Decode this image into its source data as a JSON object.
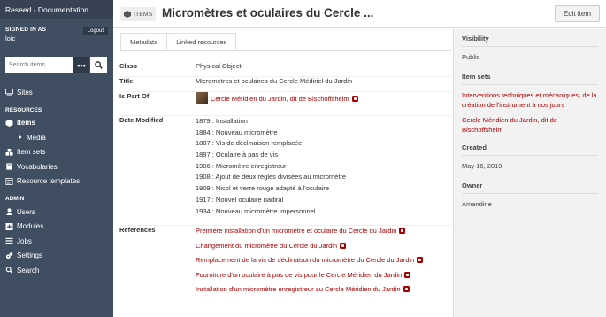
{
  "sidebar": {
    "brand": "Reseed - Documentation",
    "signed_in_label": "SIGNED IN AS",
    "user": "loic",
    "logout": "Logout",
    "search_placeholder": "Search items",
    "search_options_glyph": "•••",
    "search_button_icon": "search-icon",
    "nav": {
      "sites": "Sites",
      "resources_head": "RESOURCES",
      "items": "Items",
      "media": "Media",
      "item_sets": "Item sets",
      "vocabularies": "Vocabularies",
      "resource_templates": "Resource templates",
      "admin_head": "ADMIN",
      "users": "Users",
      "modules": "Modules",
      "jobs": "Jobs",
      "settings": "Settings",
      "search": "Search"
    }
  },
  "header": {
    "tag": "ITEMS",
    "title": "Micromètres et oculaires du Cercle ...",
    "edit": "Edit item"
  },
  "tabs": [
    "Metadata",
    "Linked resources"
  ],
  "properties": {
    "class_label": "Class",
    "class_value": "Physical Object",
    "title_label": "Title",
    "title_value": "Micromètres et oculaires du Cercle Médiriel du Jardin",
    "is_part_of_label": "Is Part Of",
    "is_part_of_value": "Cercle Méridien du Jardin, dit de Bischoffsheim",
    "date_modified_label": "Date Modified",
    "dates": [
      "1879 : Installation",
      "1884 : Nouveau micromètre",
      "1887 : Vis de déclinaison remplacée",
      "1897 : Oculaire à pas de vis",
      "1906 : Micromètre enregistreur",
      "1908 : Ajout de deux règles divisées au micromètre",
      "1909 : Nicol et verre rouge adapté à l'oculaire",
      "1917 : Nouvel oculaire nadiral",
      "1934 : Nouveau micromètre impersonnel"
    ],
    "references_label": "References",
    "references": [
      "Première installation d'un micromètre et oculaire du Cercle du Jardin",
      "Changement du micromètre du Cercle du Jardin",
      "Remplacement de la vis de déclinaison du micromètre du Cercle du Jardin",
      "Fourniture d'un oculaire à pas de vis pour le Cercle Méridien du Jardin",
      "Installation d'un micromètre enregistreur au Cercle Méridien du Jardin"
    ]
  },
  "right_panel": {
    "visibility_label": "Visibility",
    "visibility_value": "Public",
    "item_sets_label": "Item sets",
    "item_sets": [
      "Interventions techniques et mécaniques, de la création de l'instrument à nos jours",
      "Cercle Méridien du Jardin, dit de Bischoffsheim"
    ],
    "created_label": "Created",
    "created_value": "May 16, 2019",
    "owner_label": "Owner",
    "owner_value": "Amandine"
  },
  "colors": {
    "sidebar_bg": "#404e61",
    "link": "#aa0000",
    "right_panel_bg": "#f2f2f2"
  }
}
